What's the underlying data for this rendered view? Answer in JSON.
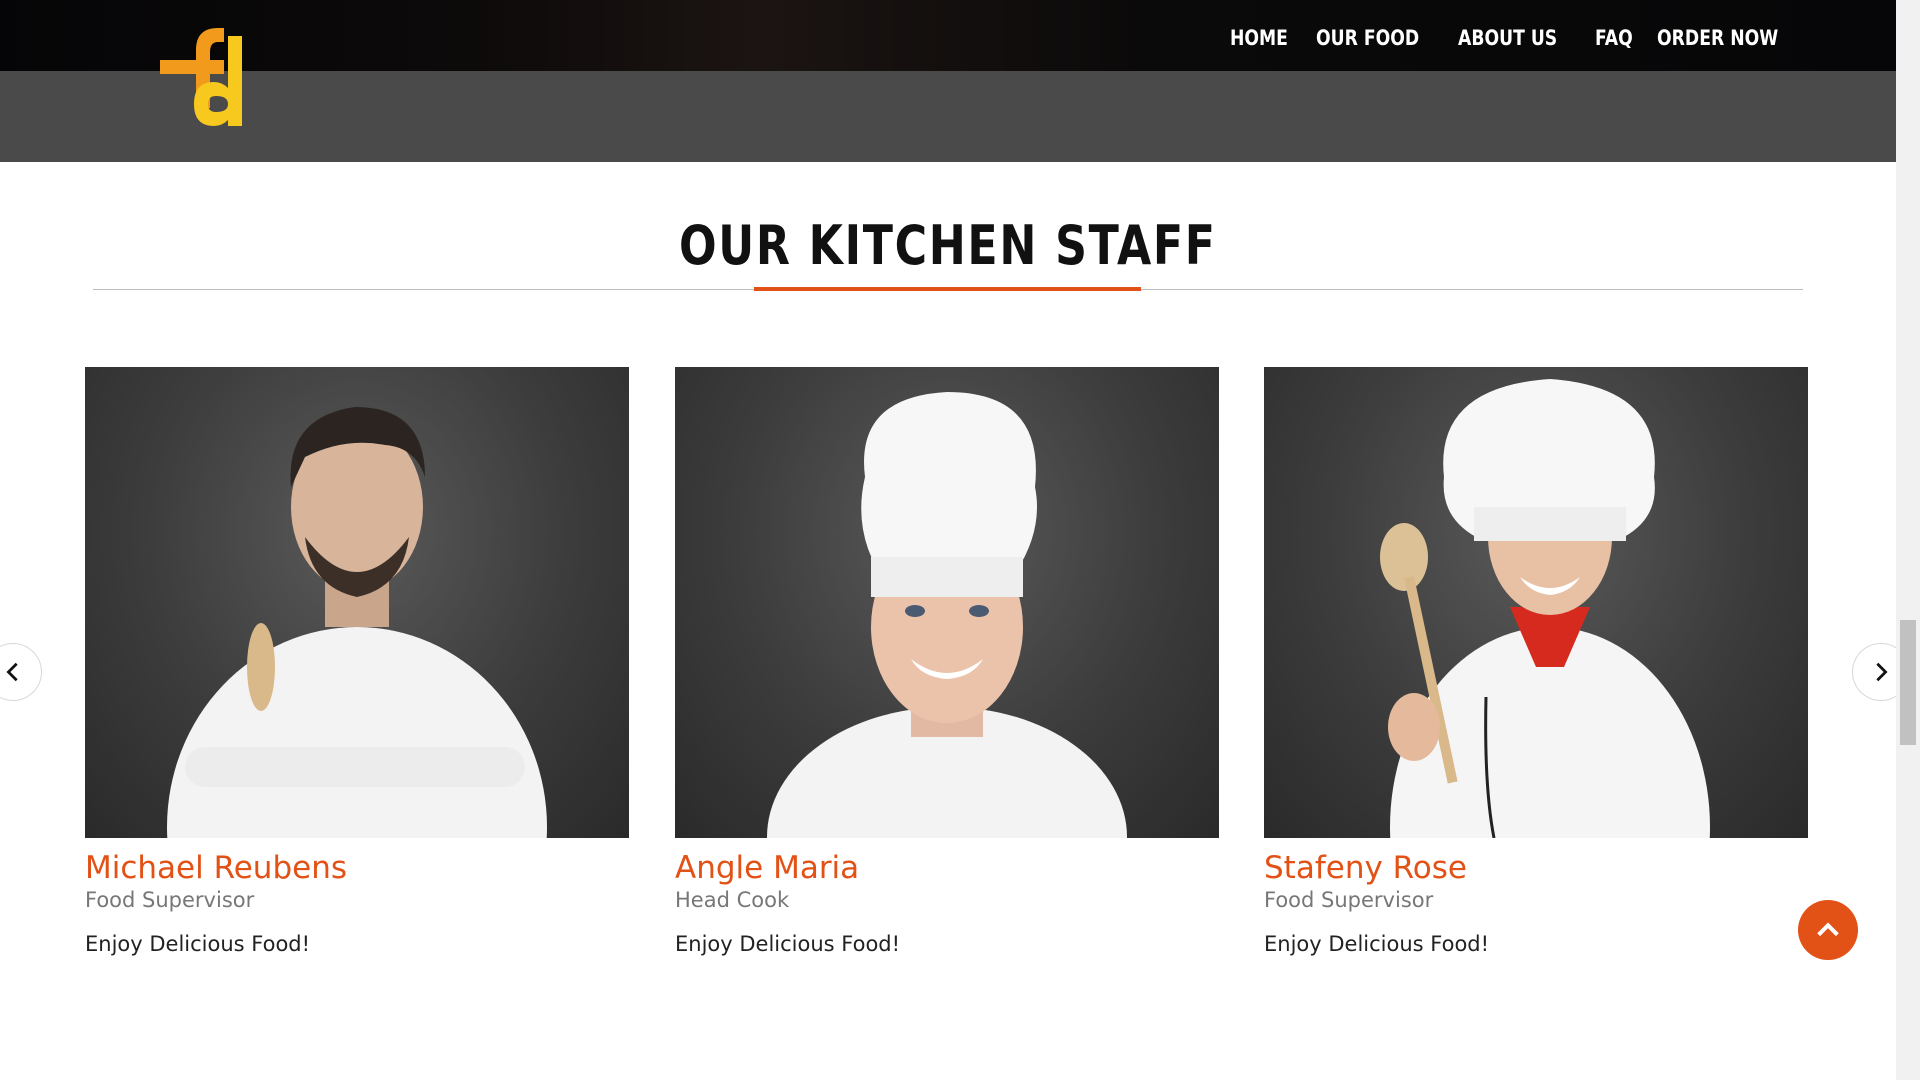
{
  "nav": {
    "items": [
      "HOME",
      "OUR FOOD",
      "ABOUT US",
      "FAQ",
      "ORDER NOW"
    ]
  },
  "logo": {
    "text": "fd"
  },
  "section": {
    "title": "OUR KITCHEN STAFF"
  },
  "staff": [
    {
      "name": "Michael Reubens",
      "role": "Food Supervisor",
      "text": "Enjoy Delicious Food!"
    },
    {
      "name": "Angle Maria",
      "role": "Head Cook",
      "text": "Enjoy Delicious Food!"
    },
    {
      "name": "Stafeny Rose",
      "role": "Food Supervisor",
      "text": "Enjoy Delicious Food!"
    }
  ],
  "colors": {
    "accent": "#e25116",
    "logo_orange": "#f29a1c",
    "logo_yellow": "#f7c81d",
    "header_gray": "#4a4a4a"
  },
  "icons": {
    "prev": "chevron-left-icon",
    "next": "chevron-right-icon",
    "scroll_top": "chevron-up-icon"
  }
}
